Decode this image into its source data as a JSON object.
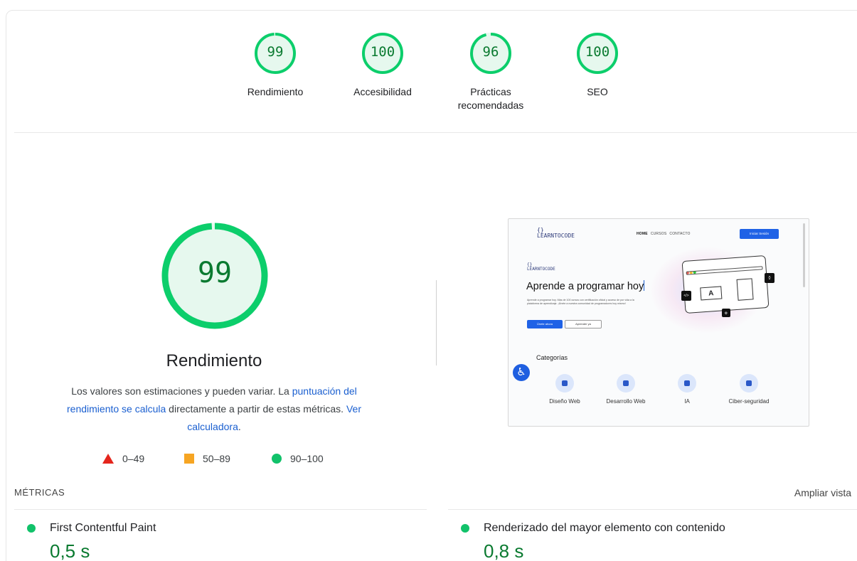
{
  "categories": [
    {
      "score": "99",
      "label": "Rendimiento",
      "fraction": 0.99
    },
    {
      "score": "100",
      "label": "Accesibilidad",
      "fraction": 1.0
    },
    {
      "score": "96",
      "label": "Prácticas recomendadas",
      "fraction": 0.96
    },
    {
      "score": "100",
      "label": "SEO",
      "fraction": 1.0
    }
  ],
  "performance": {
    "score": "99",
    "fraction": 0.99,
    "title": "Rendimiento",
    "desc_part1": "Los valores son estimaciones y pueden variar. La ",
    "desc_link1": "puntuación del rendimiento se calcula",
    "desc_part2": " directamente a partir de estas métricas. ",
    "desc_link2": "Ver calculadora",
    "desc_part3": "."
  },
  "legend": {
    "fail": "0–49",
    "average": "50–89",
    "pass": "90–100"
  },
  "colors": {
    "pass": "#0cce6b",
    "pass_text": "#0a7a30",
    "average": "#f6a523",
    "fail": "#e4251c",
    "link": "#1a5fd0"
  },
  "screenshot": {
    "logo_text": "LEARNTOCODE",
    "nav": [
      "HOME",
      "CURSOS",
      "CONTACTO"
    ],
    "login_button": "Iniciar Sesión",
    "hero_title": "Aprende a programar hoy",
    "hero_text": "Aprende a programar hoy. Más de 100 cursos con certificación oficial y acceso de por vida a la plataforma de aprendizaje. ¡Únete a nuestra comunidad de programadores hoy mismo!",
    "btn_primary": "Únete ahora",
    "btn_secondary": "Aprender ya",
    "categories_title": "Categorías",
    "category_items": [
      "Diseño Web",
      "Desarrollo Web",
      "IA",
      "Ciber-seguridad"
    ]
  },
  "metrics": {
    "title": "MÉTRICAS",
    "expand": "Ampliar vista",
    "items": [
      {
        "name": "First Contentful Paint",
        "value": "0,5 s"
      },
      {
        "name": "Renderizado del mayor elemento con contenido",
        "value": "0,8 s"
      }
    ]
  }
}
